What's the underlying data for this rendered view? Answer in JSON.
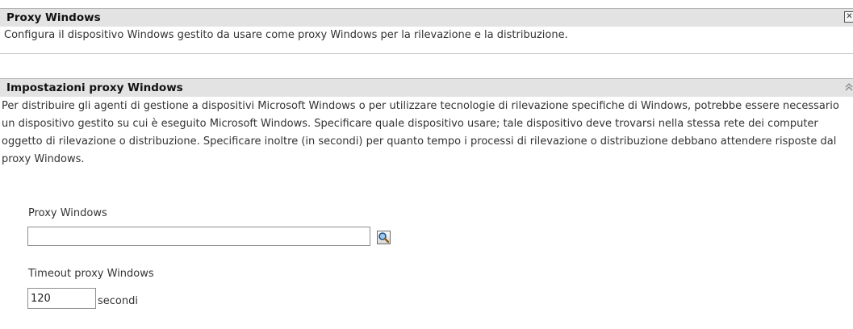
{
  "proxy_section": {
    "title": "Proxy Windows",
    "close_icon": "close-icon",
    "description": "Configura il dispositivo Windows gestito da usare come proxy Windows per la rilevazione e la distribuzione."
  },
  "settings_section": {
    "title": "Impostazioni proxy Windows",
    "collapse_icon": "collapse-icon",
    "description": "Per distribuire gli agenti di gestione a dispositivi Microsoft Windows o per utilizzare tecnologie di rilevazione specifiche di Windows, potrebbe essere necessario un dispositivo gestito su cui è eseguito Microsoft Windows. Specificare quale dispositivo usare; tale dispositivo deve trovarsi nella stessa rete dei computer oggetto di rilevazione o distribuzione. Specificare inoltre (in secondi) per quanto tempo i processi di rilevazione o distribuzione debbano attendere risposte dal proxy Windows."
  },
  "form": {
    "proxy_label": "Proxy Windows",
    "proxy_value": "",
    "search_icon": "magnifier-icon",
    "timeout_label": "Timeout proxy Windows",
    "timeout_value": "120",
    "timeout_unit": "secondi"
  }
}
